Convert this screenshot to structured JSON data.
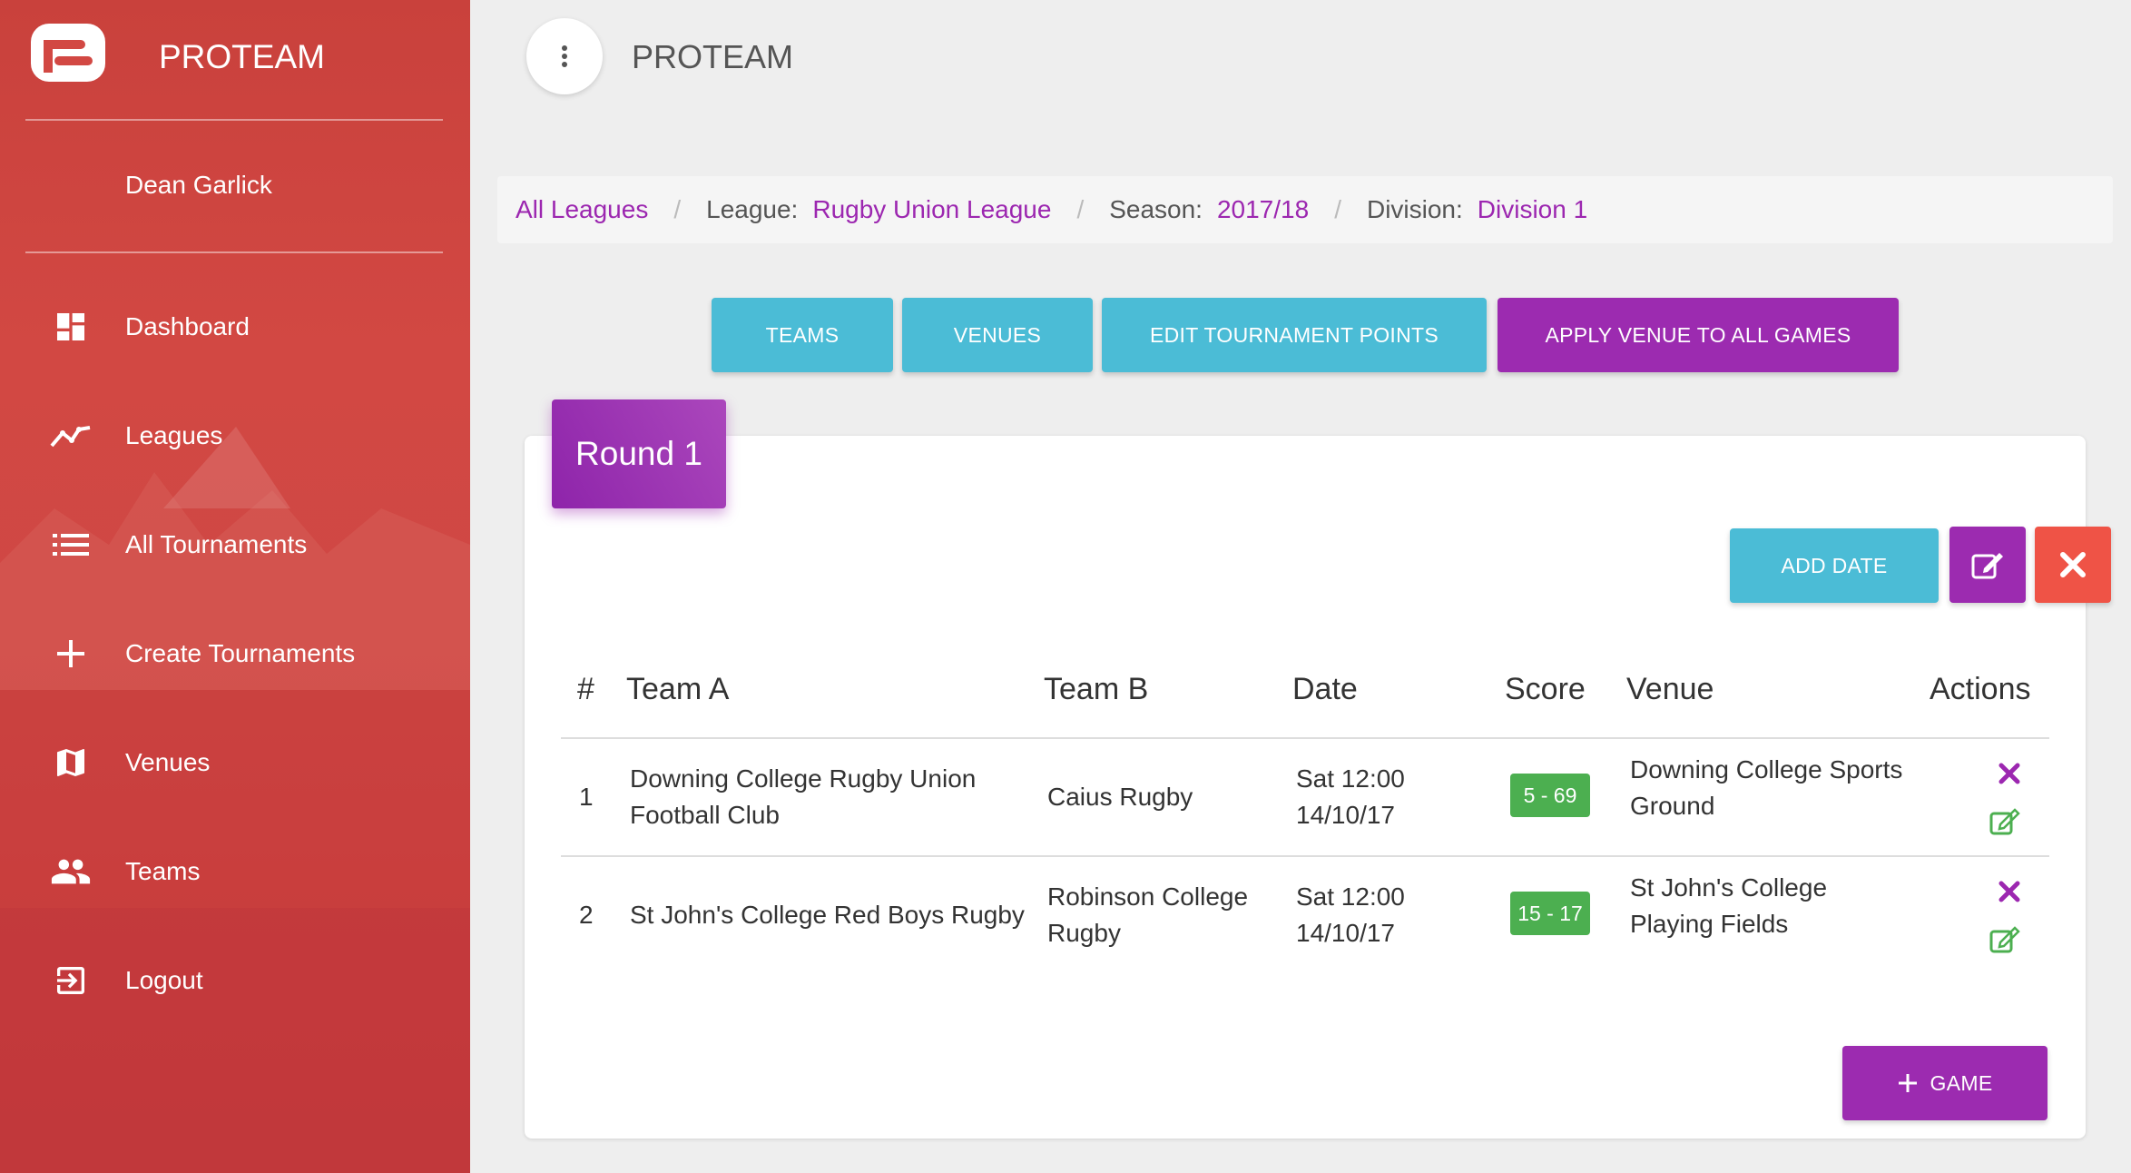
{
  "colors": {
    "sidebar": "#cf4744",
    "accent_purple": "#9c27b0",
    "info": "#4bbcd6",
    "danger": "#ef5346",
    "success": "#4caf50"
  },
  "sidebar": {
    "brand": "PROTEAM",
    "user": "Dean Garlick",
    "items": [
      {
        "label": "Dashboard",
        "icon": "dashboard-icon"
      },
      {
        "label": "Leagues",
        "icon": "timeline-icon"
      },
      {
        "label": "All Tournaments",
        "icon": "list-icon"
      },
      {
        "label": "Create Tournaments",
        "icon": "plus-icon"
      },
      {
        "label": "Venues",
        "icon": "map-icon"
      },
      {
        "label": "Teams",
        "icon": "people-icon"
      },
      {
        "label": "Logout",
        "icon": "logout-icon"
      }
    ]
  },
  "header": {
    "title": "PROTEAM",
    "menu_icon": "more-vert-icon"
  },
  "breadcrumb": {
    "all_leagues": "All Leagues",
    "league_label": "League:",
    "league": "Rugby Union League",
    "season_label": "Season:",
    "season": "2017/18",
    "division_label": "Division:",
    "division": "Division 1",
    "separator": "/"
  },
  "actions": {
    "teams": "TEAMS",
    "venues": "VENUES",
    "edit_points": "EDIT TOURNAMENT POINTS",
    "apply_venue": "APPLY VENUE TO ALL GAMES"
  },
  "round": {
    "title": "Round 1",
    "add_date": "ADD DATE",
    "add_game": "GAME",
    "columns": [
      "#",
      "Team A",
      "Team B",
      "Date",
      "Score",
      "Venue",
      "Actions"
    ],
    "games": [
      {
        "num": "1",
        "team_a": "Downing College Rugby Union Football Club",
        "team_b": "Caius Rugby",
        "date": "Sat 12:00 14/10/17",
        "score": "5 - 69",
        "venue": "Downing College Sports Ground"
      },
      {
        "num": "2",
        "team_a": "St John's College Red Boys Rugby",
        "team_b": "Robinson College Rugby",
        "date": "Sat 12:00 14/10/17",
        "score": "15 - 17",
        "venue": "St John's College Playing Fields"
      }
    ]
  }
}
